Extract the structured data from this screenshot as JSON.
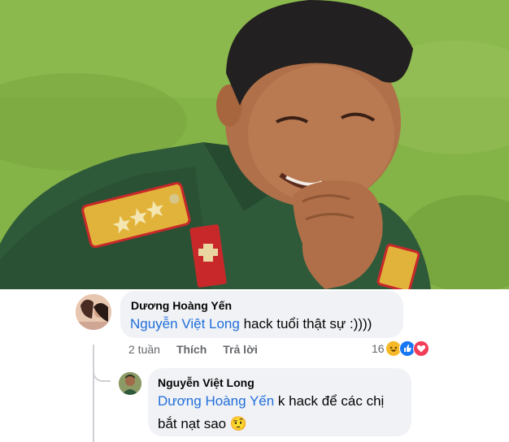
{
  "comments": [
    {
      "author": "Dương Hoàng Yến",
      "mention": "Nguyễn Việt Long",
      "text": " hack tuổi thật sự :))))",
      "time": "2 tuần",
      "like_label": "Thích",
      "reply_label": "Trả lời",
      "reaction_count": "16",
      "reactions": [
        "haha-icon",
        "like-icon",
        "love-icon"
      ]
    },
    {
      "author": "Nguyễn Việt Long",
      "mention": "Dương Hoàng Yến",
      "text_line1": " k hack để các chị",
      "text_line2": "bắt nạt sao ",
      "emoji": "🤨"
    }
  ],
  "colors": {
    "mention": "#216fdb",
    "bubble": "#f0f2f5",
    "meta": "#65676b",
    "uniform": "#2f5a3a",
    "grass": "#7fae42"
  }
}
